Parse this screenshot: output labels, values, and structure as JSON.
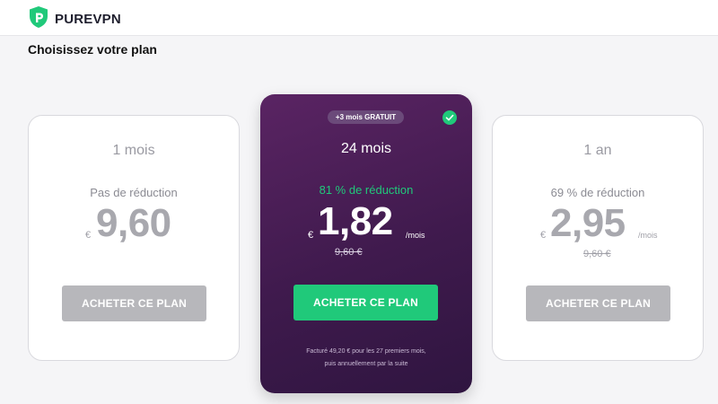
{
  "header": {
    "brand": "PUREVPN",
    "logo_icon": "purevpn-shield-logo-icon"
  },
  "page": {
    "title": "Choisissez votre plan"
  },
  "plans": [
    {
      "duration": "1 mois",
      "discount": "Pas de réduction",
      "currency": "€",
      "amount": "9,60",
      "per_month": "",
      "old_price": "",
      "button": "ACHETER CE PLAN"
    },
    {
      "duration": "24 mois",
      "badge": "+3 mois GRATUIT",
      "selected": true,
      "discount": "81 % de réduction",
      "currency": "€",
      "amount": "1,82",
      "per_month": "/mois",
      "old_price": "9,60 €",
      "button": "ACHETER CE PLAN",
      "billing_line_1": "Facturé 49,20 € pour les 27 premiers mois,",
      "billing_line_2": "puis annuellement par la suite"
    },
    {
      "duration": "1 an",
      "discount": "69 % de réduction",
      "currency": "€",
      "amount": "2,95",
      "per_month": "/mois",
      "old_price": "9,60 €",
      "button": "ACHETER CE PLAN"
    }
  ],
  "colors": {
    "accent": "#20c97a",
    "featured_card": "#4a1f58",
    "disabled_button": "#b7b7bb"
  }
}
